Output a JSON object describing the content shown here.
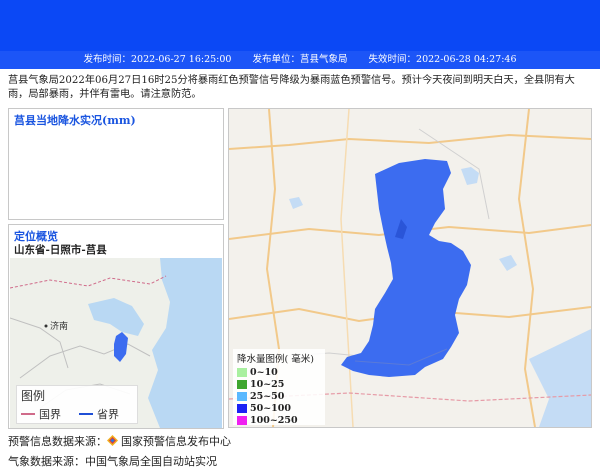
{
  "header": {
    "publish_time": "发布时间：2022-06-27 16:25:00",
    "publisher": "发布单位：莒县气象局",
    "expire_time": "失效时间：2022-06-28 04:27:46",
    "banner_color": "#0b48f5"
  },
  "description": "莒县气象局2022年06月27日16时25分将暴雨红色预警信号降级为暴雨蓝色预警信号。预计今天夜间到明天白天，全县阴有大雨，局部暴雨，并伴有雷电。请注意防范。",
  "rainfall_panel": {
    "title": "莒县当地降水实况(mm)"
  },
  "location_panel": {
    "title": "定位概览",
    "region": "山东省-日照市-莒县",
    "map_labels": {
      "city": "济南"
    },
    "legend": {
      "title": "图例",
      "items": [
        {
          "label": "国界",
          "color": "#d06b8a"
        },
        {
          "label": "省界",
          "color": "#1f4fd6"
        }
      ]
    }
  },
  "main_map": {
    "legend_title": "降水量图例( 毫米)",
    "legend_items": [
      {
        "label": "0~10",
        "color": "#a9f0a0"
      },
      {
        "label": "10~25",
        "color": "#3ea62e"
      },
      {
        "label": "25~50",
        "color": "#5ab8ff"
      },
      {
        "label": "50~100",
        "color": "#1b22f5"
      },
      {
        "label": "100~250",
        "color": "#ef20f0"
      }
    ],
    "warning_area_color": "#3c6cf0"
  },
  "footer": {
    "warning_source_label": "预警信息数据来源：",
    "warning_source": "国家预警信息发布中心",
    "weather_source": "气象数据来源：中国气象局全国自动站实况"
  }
}
